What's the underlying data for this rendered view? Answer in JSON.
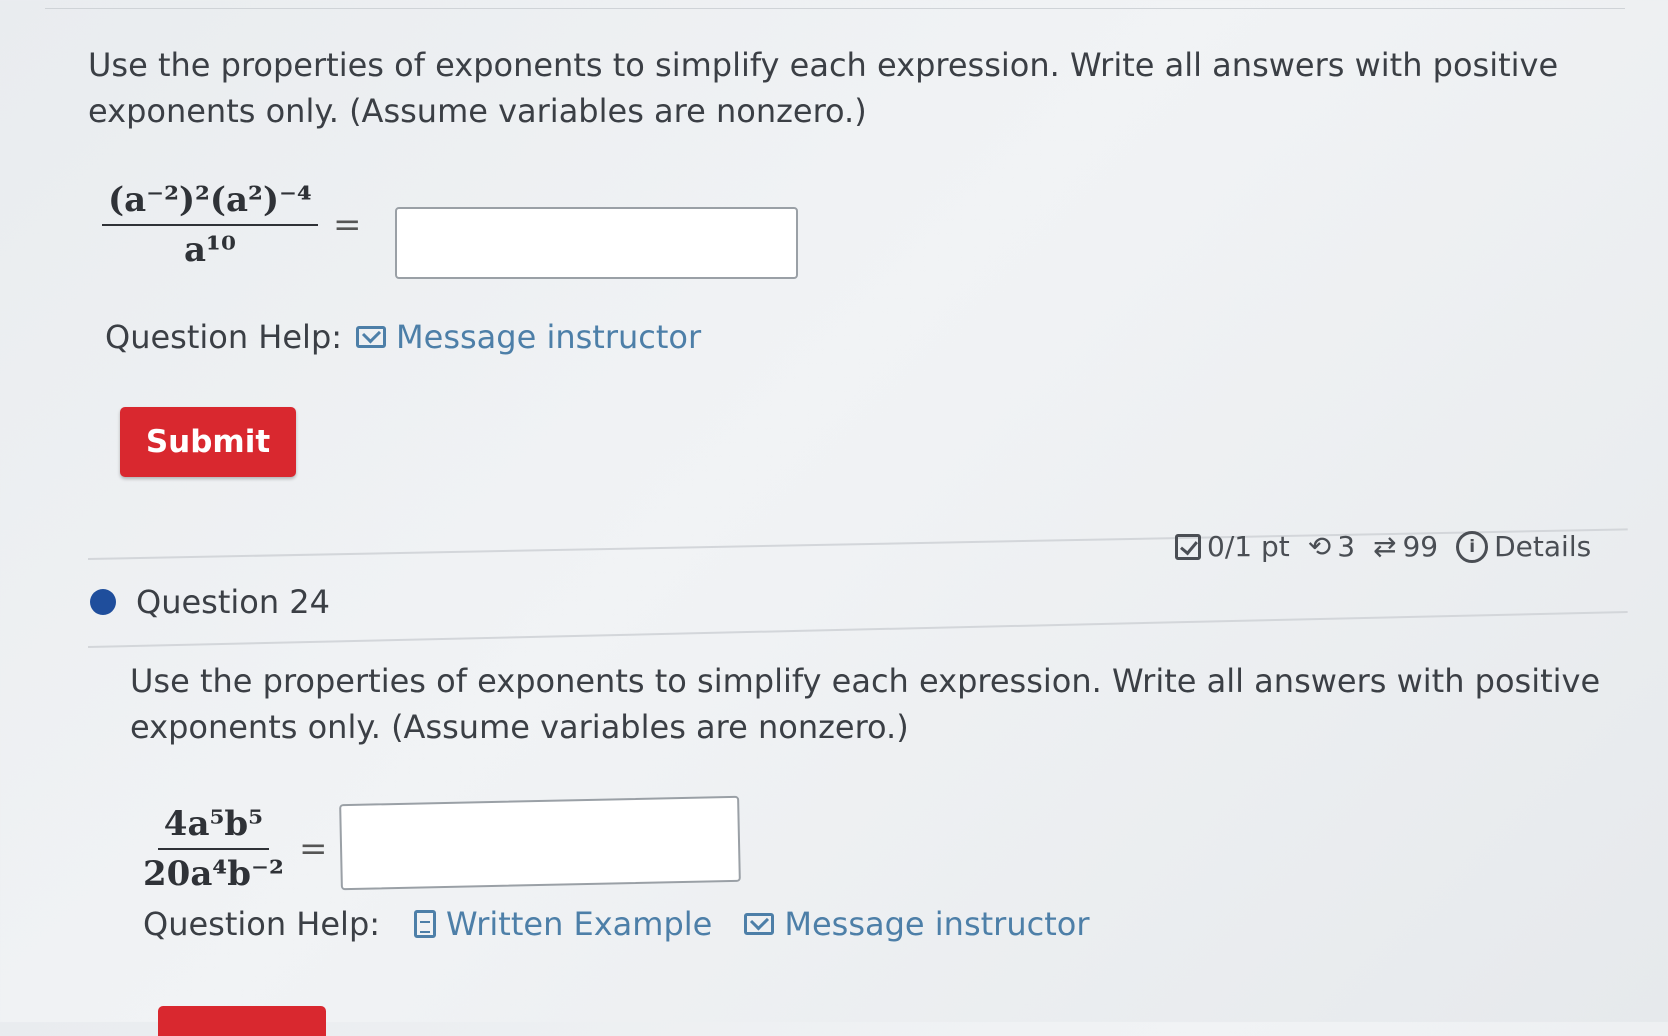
{
  "question23": {
    "prompt_line1": "Use the properties of exponents to simplify each expression. Write all answers with positive",
    "prompt_line2": "exponents only. (Assume variables are nonzero.)",
    "expr_num_html": "(a⁻²)²(a²)⁻⁴",
    "expr_den": "a¹⁰",
    "equals": "=",
    "answer_value": "",
    "help_label": "Question Help:",
    "message_label": "Message instructor",
    "submit_label": "Submit"
  },
  "question24": {
    "points": "0/1 pt",
    "retries": "3",
    "attempts": "99",
    "details_label": "Details",
    "title": "Question 24",
    "prompt_line1": "Use the properties of exponents to simplify each expression. Write all answers with positive",
    "prompt_line2": "exponents only. (Assume variables are nonzero.)",
    "expr_num": "4a⁵b⁵",
    "expr_den": "20a⁴b⁻²",
    "equals": "=",
    "answer_value": "",
    "help_label": "Question Help:",
    "example_label": "Written Example",
    "message_label": "Message instructor"
  },
  "colors": {
    "submit": "#d9282f",
    "link": "#4d7fa8",
    "dot": "#1f4e9c"
  },
  "icons": [
    "envelope-icon",
    "document-icon",
    "checkbox-icon",
    "retry-icon",
    "attempts-icon",
    "info-icon"
  ]
}
